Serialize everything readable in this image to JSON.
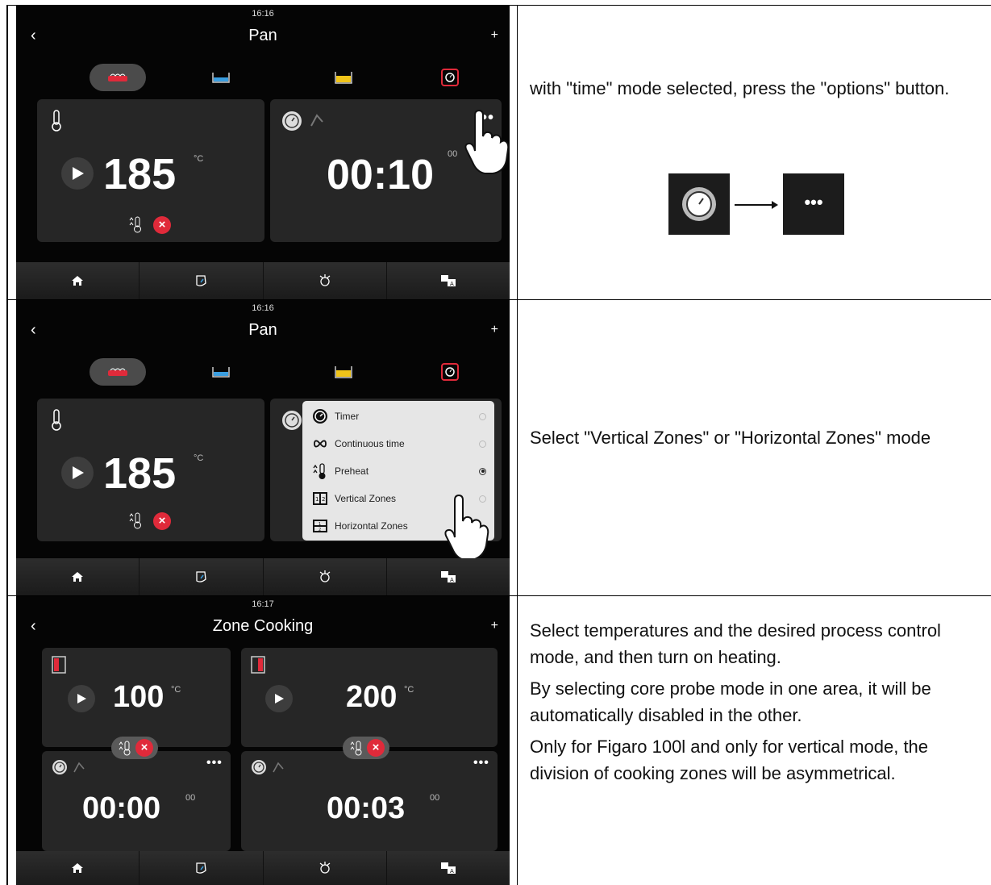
{
  "colors": {
    "screen_bg": "#050505",
    "card_bg": "#262626",
    "accent_red": "#e02a3a",
    "popup_bg": "#e6e6e6"
  },
  "step1": {
    "clock": "16:16",
    "title": "Pan",
    "back_icon": "chevron-left-icon",
    "add_icon": "plus-icon",
    "temperature": "185",
    "temp_unit": "°C",
    "time": "00:10",
    "seconds": "00",
    "options_label": "•••",
    "instruction": "with \"time\" mode selected, press the \"options\" button.",
    "diagram_options_label": "•••"
  },
  "step2": {
    "clock": "16:16",
    "title": "Pan",
    "temperature": "185",
    "temp_unit": "°C",
    "menu": [
      {
        "label": "Timer",
        "icon": "timer-icon",
        "selected": false
      },
      {
        "label": "Continuous time",
        "icon": "infinity-icon",
        "selected": false
      },
      {
        "label": "Preheat",
        "icon": "preheat-icon",
        "selected": true
      },
      {
        "label": "Vertical Zones",
        "icon": "vertical-zones-icon",
        "selected": false
      },
      {
        "label": "Horizontal Zones",
        "icon": "horizontal-zones-icon",
        "selected": false
      }
    ],
    "instruction": "Select \"Vertical Zones\" or \"Horizontal Zones\" mode"
  },
  "step3": {
    "clock": "16:17",
    "title": "Zone Cooking",
    "zone1_temp": "100",
    "zone2_temp": "200",
    "temp_unit": "°C",
    "zone1_time": "00:00",
    "zone2_time": "00:03",
    "seconds": "00",
    "options_label": "•••",
    "instruction_1": "Select temperatures and the desired process control mode, and then turn on heating.",
    "instruction_2": "By selecting core probe mode in one area, it will be automatically disabled in the other.",
    "instruction_3": "Only for Figaro 100l and only for vertical mode, the division of cooking zones will be asymmetrical."
  },
  "nav": [
    "home-icon",
    "gauge-icon",
    "cleaning-icon",
    "language-icon"
  ]
}
